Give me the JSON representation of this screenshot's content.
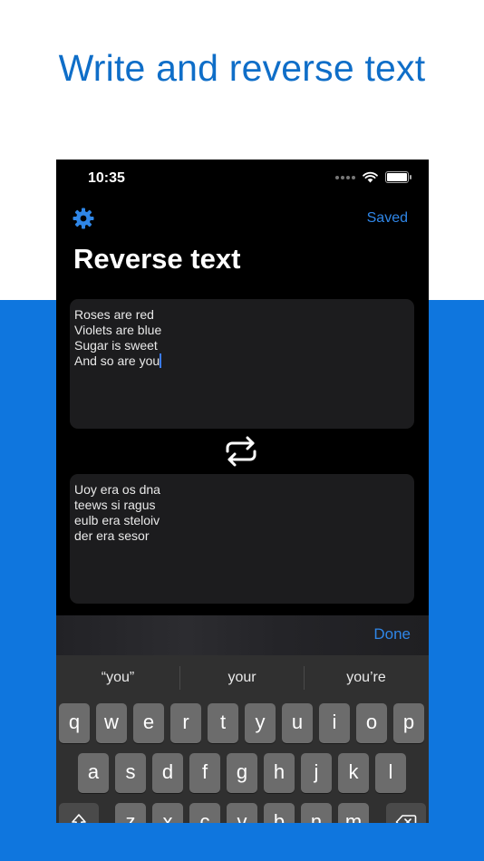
{
  "headline": "Write and reverse text",
  "status_bar": {
    "time": "10:35"
  },
  "nav": {
    "settings_icon": "gear-icon",
    "saved_label": "Saved"
  },
  "page_title": "Reverse text",
  "input_text": {
    "lines": [
      "Roses are red",
      "Violets are blue",
      "Sugar is sweet",
      "And so are you"
    ]
  },
  "swap_icon": "repeat-arrows-icon",
  "output_text": {
    "lines": [
      "Uoy era os dna",
      "teews si ragus",
      "eulb era steloiv",
      "der era sesor"
    ]
  },
  "accessory": {
    "done_label": "Done"
  },
  "keyboard": {
    "suggestions": [
      "“you”",
      "your",
      "you’re"
    ],
    "row1": [
      "q",
      "w",
      "e",
      "r",
      "t",
      "y",
      "u",
      "i",
      "o",
      "p"
    ],
    "row2": [
      "a",
      "s",
      "d",
      "f",
      "g",
      "h",
      "j",
      "k",
      "l"
    ],
    "row3": [
      "z",
      "x",
      "c",
      "v",
      "b",
      "n",
      "m"
    ]
  },
  "colors": {
    "brand_blue": "#0f76de",
    "headline_blue": "#0f6ec8",
    "accent": "#2f86e7",
    "caret": "#3a7bf5"
  }
}
